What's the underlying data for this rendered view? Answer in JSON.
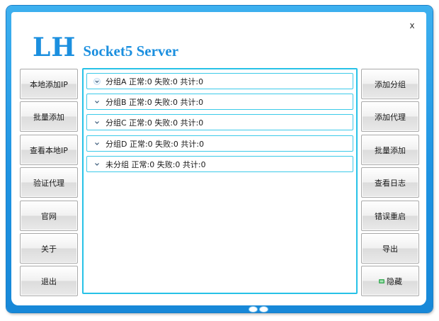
{
  "app": {
    "title_main": "LH",
    "title_rest": "Socket5 Server",
    "close_label": "x"
  },
  "left_buttons": [
    {
      "label": "本地添加IP"
    },
    {
      "label": "批量添加"
    },
    {
      "label": "查看本地IP"
    },
    {
      "label": "验证代理"
    },
    {
      "label": "官网"
    },
    {
      "label": "关于"
    },
    {
      "label": "退出"
    }
  ],
  "right_buttons": [
    {
      "label": "添加分组"
    },
    {
      "label": "添加代理"
    },
    {
      "label": "批量添加"
    },
    {
      "label": "查看日志"
    },
    {
      "label": "错误重启"
    },
    {
      "label": "导出"
    },
    {
      "label": "隐藏"
    }
  ],
  "groups": [
    {
      "label": "分组A 正常:0 失败:0 共计:0"
    },
    {
      "label": "分组B 正常:0 失败:0 共计:0"
    },
    {
      "label": "分组C 正常:0 失败:0 共计:0"
    },
    {
      "label": "分组D 正常:0 失败:0 共计:0"
    },
    {
      "label": "未分组 正常:0 失败:0 共计:0"
    }
  ],
  "colors": {
    "frame_blue": "#1e93e2",
    "title_blue": "#1b8fdf",
    "panel_border": "#27c2e7"
  },
  "icons": {
    "group_toggle": "chevron-down-icon",
    "hide_button": "hide-icon",
    "footer": "footer-dots-icon"
  }
}
